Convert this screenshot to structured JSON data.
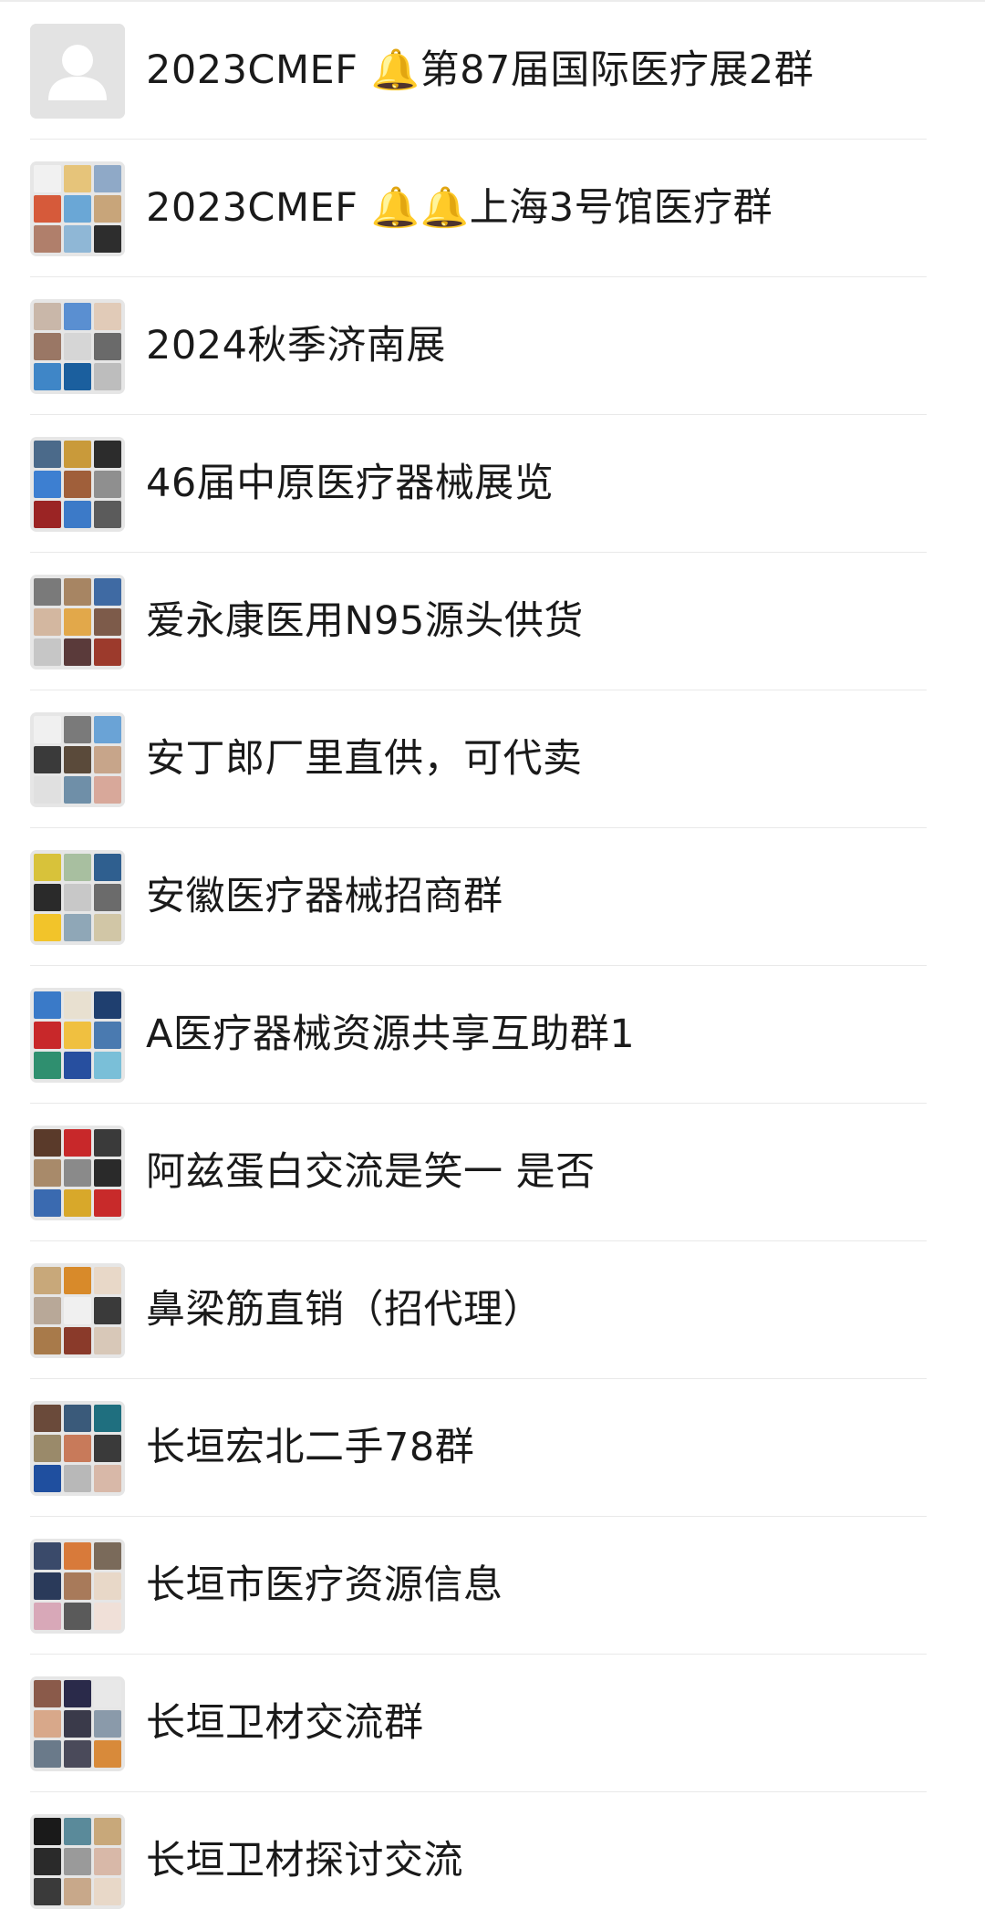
{
  "groups": [
    {
      "name": "2023CMEF 🔔第87届国际医疗展2群",
      "avatar": "default-person-icon",
      "tiles": []
    },
    {
      "name": "2023CMEF 🔔🔔上海3号馆医疗群",
      "avatar": "group-collage",
      "tiles": [
        "#f1f1f1",
        "#e6c47a",
        "#8fa9c7",
        "#d65a3a",
        "#6aa7d6",
        "#c8a57a",
        "#b07f6b",
        "#8fb7d6",
        "#2d2d2d"
      ]
    },
    {
      "name": "2024秋季济南展",
      "avatar": "group-collage",
      "tiles": [
        "#c9b7a9",
        "#5a8fd1",
        "#e1cbb8",
        "#9a7765",
        "#d6d6d6",
        "#6a6a6a",
        "#3f86c7",
        "#1b5f9e",
        "#bdbdbd"
      ]
    },
    {
      "name": "46届中原医疗器械展览",
      "avatar": "group-collage",
      "tiles": [
        "#4b6a8a",
        "#c99a3a",
        "#2c2c2c",
        "#3d7fd1",
        "#a05f3a",
        "#8f8f8f",
        "#9b2424",
        "#3c7ac8",
        "#5b5b5b"
      ]
    },
    {
      "name": "爱永康医用N95源头供货",
      "avatar": "group-collage",
      "tiles": [
        "#7a7a7a",
        "#a78563",
        "#3f6aa3",
        "#d3b7a0",
        "#e2a84a",
        "#7d5b4a",
        "#c6c6c6",
        "#5a3a3a",
        "#9c3a2c"
      ]
    },
    {
      "name": "安丁郎厂里直供，可代卖",
      "avatar": "group-collage",
      "tiles": [
        "#f0f0f0",
        "#7a7a7a",
        "#6aa3d6",
        "#3a3a3a",
        "#5a4a3a",
        "#c7a58a",
        "#e0e0e0",
        "#6f8fa8",
        "#d8a89a"
      ]
    },
    {
      "name": "安徽医疗器械招商群",
      "avatar": "group-collage",
      "tiles": [
        "#d8c23a",
        "#a8bfa0",
        "#2f5f8f",
        "#2a2a2a",
        "#c8c8c8",
        "#6b6b6b",
        "#f2c42a",
        "#8fa7b7",
        "#d1c6a6"
      ]
    },
    {
      "name": "A医疗器械资源共享互助群1",
      "avatar": "group-collage",
      "tiles": [
        "#3a7ac8",
        "#e8e0d0",
        "#1f3f6f",
        "#c8282a",
        "#f0c040",
        "#4a7ab0",
        "#2f8f6f",
        "#274f9f",
        "#7abfd8"
      ]
    },
    {
      "name": "阿兹蛋白交流是笑一 是否",
      "avatar": "group-collage",
      "tiles": [
        "#5a3a2a",
        "#c8282a",
        "#3a3a3a",
        "#a88a6a",
        "#8a8a8a",
        "#2a2a2a",
        "#3a6ab0",
        "#d8a82a",
        "#c82a2a"
      ]
    },
    {
      "name": "鼻梁筋直销（招代理）",
      "avatar": "group-collage",
      "tiles": [
        "#c8a87a",
        "#d88a2a",
        "#e8d8c8",
        "#b8a898",
        "#f0f0f0",
        "#3a3a3a",
        "#a87a4a",
        "#8a3a2a",
        "#d8c8b8"
      ]
    },
    {
      "name": "长垣宏北二手78群",
      "avatar": "group-collage",
      "tiles": [
        "#6a4a3a",
        "#3a5a7a",
        "#1f6f7f",
        "#9a8a6a",
        "#c87a5a",
        "#3a3a3a",
        "#1f4f9f",
        "#b8b8b8",
        "#d8b8a8"
      ]
    },
    {
      "name": "长垣市医疗资源信息",
      "avatar": "group-collage",
      "tiles": [
        "#3a4a6a",
        "#d87a3a",
        "#7a6a5a",
        "#2a3a5a",
        "#a87a5a",
        "#e8d8c8",
        "#d8a8b8",
        "#5a5a5a",
        "#f0e0d8"
      ]
    },
    {
      "name": "长垣卫材交流群",
      "avatar": "group-collage",
      "tiles": [
        "#8a5a4a",
        "#2a2a4a",
        "#e8e8e8",
        "#d8a88a",
        "#3a3a4a",
        "#8a9aaa",
        "#6a7a8a",
        "#4a4a5a",
        "#d88a3a"
      ]
    },
    {
      "name": "长垣卫材探讨交流",
      "avatar": "group-collage",
      "tiles": [
        "#1a1a1a",
        "#5a8a9a",
        "#c8a87a",
        "#2a2a2a",
        "#9a9a9a",
        "#d8b8a8",
        "#3a3a3a",
        "#c8a88a",
        "#e8d8c8"
      ]
    }
  ]
}
